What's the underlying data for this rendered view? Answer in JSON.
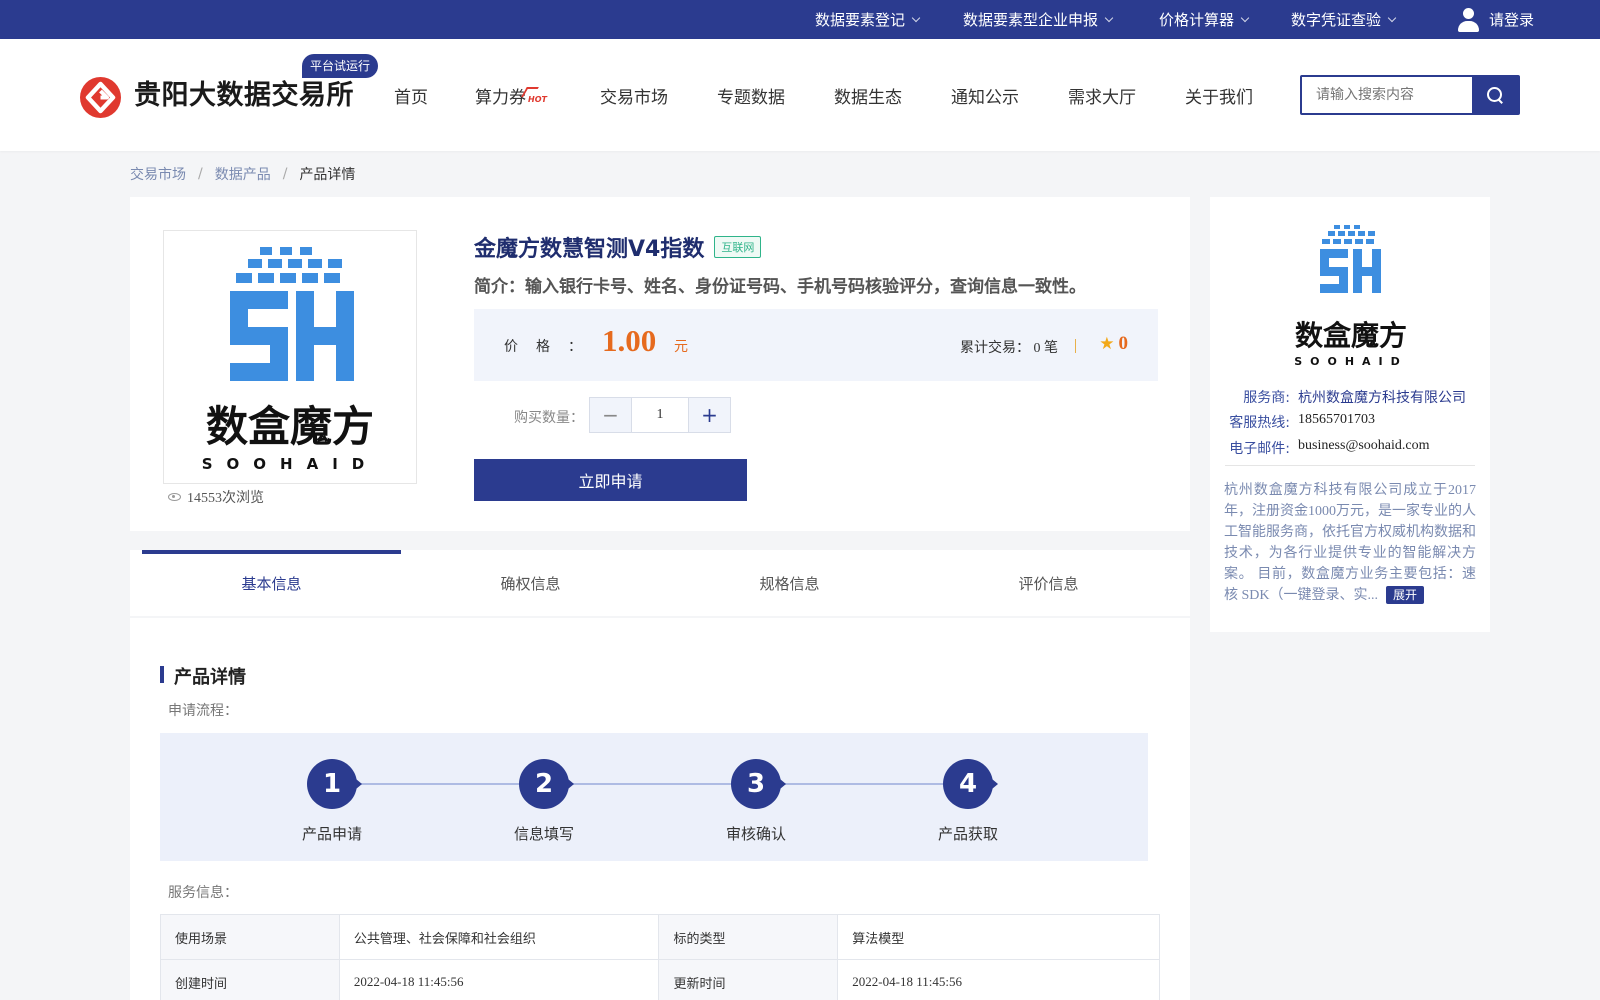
{
  "topbar": {
    "items": [
      {
        "label": "数据要素登记"
      },
      {
        "label": "数据要素型企业申报"
      },
      {
        "label": "价格计算器"
      },
      {
        "label": "数字凭证查验"
      }
    ],
    "login_label": "请登录"
  },
  "header": {
    "brand": "贵阳大数据交易所",
    "trial_badge": "平台试运行",
    "nav": [
      {
        "label": "首页"
      },
      {
        "label": "算力券",
        "hot": "HOT"
      },
      {
        "label": "交易市场"
      },
      {
        "label": "专题数据"
      },
      {
        "label": "数据生态"
      },
      {
        "label": "通知公示"
      },
      {
        "label": "需求大厅"
      },
      {
        "label": "关于我们"
      }
    ],
    "search_placeholder": "请输入搜索内容"
  },
  "breadcrumb": [
    "交易市场",
    "数据产品",
    "产品详情"
  ],
  "product": {
    "title": "金魔方数慧智测V4指数",
    "tag": "互联网",
    "intro": "简介：输入银行卡号、姓名、身份证号码、手机号码核验评分，查询信息一致性。",
    "price_label": "价格",
    "price_colon": "：",
    "price": "1.00",
    "price_unit": "元",
    "trades": "累计交易： 0 笔",
    "rating": "0",
    "qty_label": "购买数量：",
    "qty_value": "1",
    "minus": "−",
    "plus": "+",
    "apply_label": "立即申请",
    "views": "14553次浏览",
    "logo_cn": "数盒魔方",
    "logo_en": "SOOHAID"
  },
  "tabs": [
    {
      "label": "基本信息",
      "active": true
    },
    {
      "label": "确权信息"
    },
    {
      "label": "规格信息"
    },
    {
      "label": "评价信息"
    }
  ],
  "detail": {
    "section_title": "产品详情",
    "flow_label": "申请流程：",
    "steps": [
      {
        "num": "1",
        "label": "产品申请"
      },
      {
        "num": "2",
        "label": "信息填写"
      },
      {
        "num": "3",
        "label": "审核确认"
      },
      {
        "num": "4",
        "label": "产品获取"
      }
    ],
    "service_label": "服务信息：",
    "table": [
      [
        "使用场景",
        "公共管理、社会保障和社会组织",
        "标的类型",
        "算法模型"
      ],
      [
        "创建时间",
        "2022-04-18 11:45:56",
        "更新时间",
        "2022-04-18 11:45:56"
      ]
    ]
  },
  "provider": {
    "service_key": "服务商:",
    "service_val": "杭州数盒魔方科技有限公司",
    "phone_key": "客服热线:",
    "phone_val": "18565701703",
    "email_key": "电子邮件:",
    "email_val": "business@soohaid.com",
    "description": "杭州数盒魔方科技有限公司成立于2017年，注册资金1000万元，是一家专业的人工智能服务商，依托官方权威机构数据和技术，为各行业提供专业的智能解决方案。 目前，数盒魔方业务主要包括：速核 SDK（一键登录、实...",
    "expand_label": "展开"
  },
  "colors": {
    "primary": "#2b3b8f",
    "accent_orange": "#e66a1e",
    "logo_red": "#e0392f",
    "logo_blue": "#3d8ee0"
  }
}
